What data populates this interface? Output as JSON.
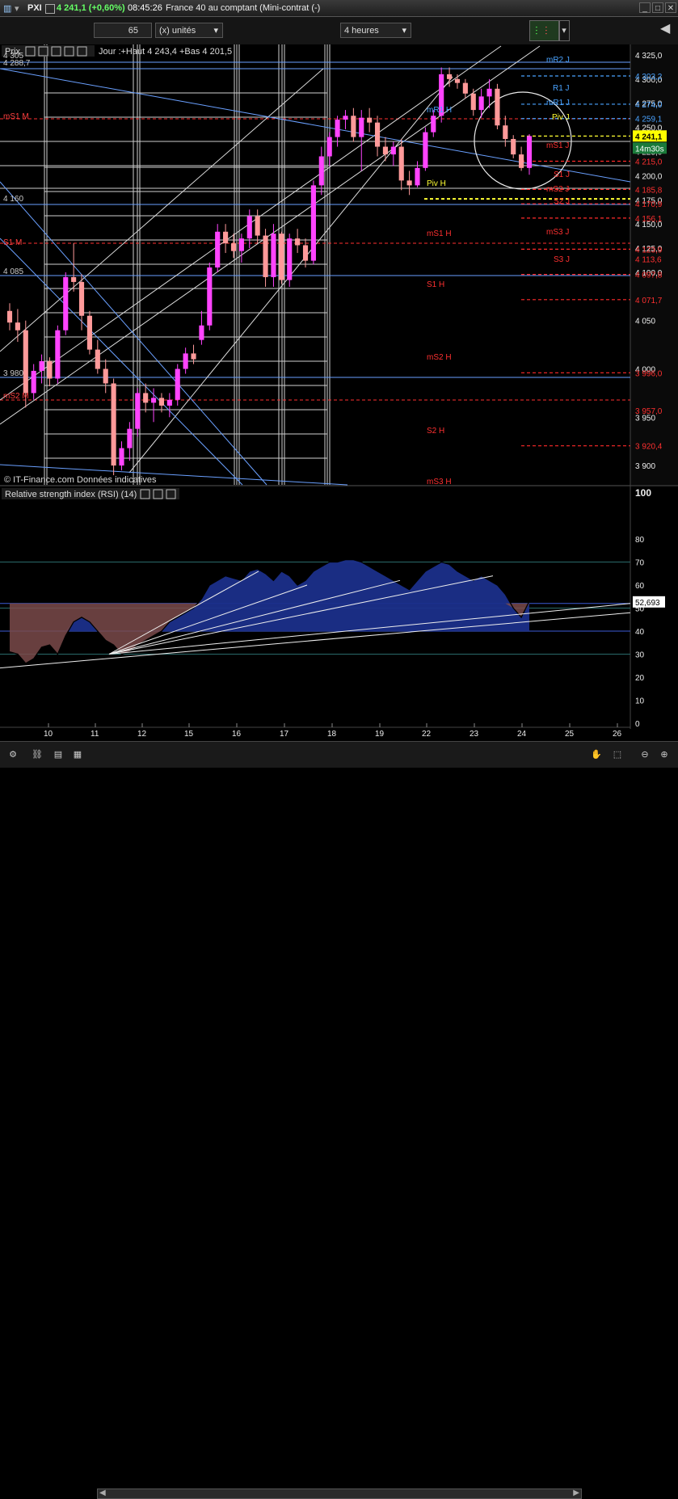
{
  "window": {
    "instrument": "PXI",
    "quote": "4 241,1 (+0,60%)",
    "time": "08:45:26",
    "title": "France 40 au comptant (Mini-contrat  (-)"
  },
  "toolbar": {
    "quantity": "65",
    "units": "(x) unités",
    "period": "4 heures"
  },
  "panel_price": {
    "label": "Prix",
    "info": "Jour :+Haut 4 243,4 +Bas 4 201,5",
    "copyright": "© IT-Finance.com Données indicatives",
    "last_price": "4 241,1",
    "countdown": "14m30s",
    "price_ticks": [
      "4 325,0",
      "4 300,0",
      "4 275,0",
      "4 250,0",
      "4 225,0",
      "4 200,0",
      "4 175,0",
      "4 150,0",
      "4 125,0",
      "4 100,0",
      "4 050",
      "4 000",
      "3 950",
      "3 900"
    ],
    "level_tags": [
      "4 303,2",
      "4 274,0",
      "4 259,1",
      "4 215,0",
      "4 185,8",
      "4 170,9",
      "4 156,1",
      "4 123,9",
      "4 113,6",
      "4 097,8",
      "4 071,7",
      "3 996,0",
      "3 957,0",
      "3 920,4"
    ],
    "left_labels": [
      "4 305",
      "4 288,7",
      "mS1 M",
      "4 160",
      "S1 M",
      "4 085",
      "3 980",
      "mS2 M"
    ],
    "pivot_labels": [
      "mR2 J",
      "R1 J",
      "mR1 J",
      "mR1 H",
      "Piv J",
      "mS1 J",
      "S1 J",
      "Piv H",
      "mS2 J",
      "S2 J",
      "mS1 H",
      "mS3 J",
      "S3 J",
      "S1 H",
      "mS2 H",
      "S2 H",
      "mS3 H"
    ]
  },
  "panel_rsi": {
    "label": "Relative strength index (RSI) (14)",
    "value": "52,693",
    "ticks": [
      "100",
      "80",
      "70",
      "60",
      "50",
      "40",
      "30",
      "20",
      "10",
      "0"
    ]
  },
  "x_axis": {
    "labels": [
      "10",
      "11",
      "12",
      "15",
      "16",
      "17",
      "18",
      "19",
      "22",
      "23",
      "24",
      "25",
      "26"
    ]
  },
  "colors": {
    "up": "#ff44ff",
    "down": "#ff9a9a",
    "support": "#ff2a2a",
    "resistance": "#4aa3ff",
    "pivot": "#ffff33",
    "rsi_fill": "#1b2f8a",
    "rsi_low_fill": "#7a4a4a"
  },
  "chart_data": {
    "type": "candlestick",
    "ylim": [
      3880,
      4335
    ],
    "candles": [
      {
        "x": 1,
        "o": 4060,
        "h": 4068,
        "l": 4040,
        "c": 4048
      },
      {
        "x": 2,
        "o": 4048,
        "h": 4062,
        "l": 4028,
        "c": 4040
      },
      {
        "x": 3,
        "o": 4040,
        "h": 4050,
        "l": 3960,
        "c": 3975
      },
      {
        "x": 4,
        "o": 3975,
        "h": 4005,
        "l": 3968,
        "c": 3998
      },
      {
        "x": 5,
        "o": 3998,
        "h": 4015,
        "l": 3985,
        "c": 4008
      },
      {
        "x": 6,
        "o": 4008,
        "h": 4012,
        "l": 3982,
        "c": 3990
      },
      {
        "x": 7,
        "o": 3990,
        "h": 4045,
        "l": 3985,
        "c": 4040
      },
      {
        "x": 8,
        "o": 4040,
        "h": 4100,
        "l": 4035,
        "c": 4095
      },
      {
        "x": 9,
        "o": 4095,
        "h": 4130,
        "l": 4080,
        "c": 4090
      },
      {
        "x": 10,
        "o": 4090,
        "h": 4098,
        "l": 4040,
        "c": 4055
      },
      {
        "x": 11,
        "o": 4055,
        "h": 4060,
        "l": 4015,
        "c": 4020
      },
      {
        "x": 12,
        "o": 4020,
        "h": 4030,
        "l": 3995,
        "c": 4000
      },
      {
        "x": 13,
        "o": 4000,
        "h": 4010,
        "l": 3975,
        "c": 3985
      },
      {
        "x": 14,
        "o": 3985,
        "h": 3990,
        "l": 3890,
        "c": 3900
      },
      {
        "x": 15,
        "o": 3900,
        "h": 3925,
        "l": 3895,
        "c": 3918
      },
      {
        "x": 16,
        "o": 3918,
        "h": 3945,
        "l": 3905,
        "c": 3938
      },
      {
        "x": 17,
        "o": 3938,
        "h": 3980,
        "l": 3930,
        "c": 3975
      },
      {
        "x": 18,
        "o": 3975,
        "h": 3985,
        "l": 3955,
        "c": 3965
      },
      {
        "x": 19,
        "o": 3965,
        "h": 3980,
        "l": 3945,
        "c": 3970
      },
      {
        "x": 20,
        "o": 3970,
        "h": 3975,
        "l": 3955,
        "c": 3962
      },
      {
        "x": 21,
        "o": 3962,
        "h": 3975,
        "l": 3950,
        "c": 3968
      },
      {
        "x": 22,
        "o": 3968,
        "h": 4005,
        "l": 3962,
        "c": 4000
      },
      {
        "x": 23,
        "o": 4000,
        "h": 4022,
        "l": 3995,
        "c": 4016
      },
      {
        "x": 24,
        "o": 4016,
        "h": 4025,
        "l": 4005,
        "c": 4010
      },
      {
        "x": 25,
        "o": 4030,
        "h": 4060,
        "l": 4025,
        "c": 4045
      },
      {
        "x": 26,
        "o": 4045,
        "h": 4110,
        "l": 4040,
        "c": 4105
      },
      {
        "x": 27,
        "o": 4105,
        "h": 4150,
        "l": 4100,
        "c": 4142
      },
      {
        "x": 28,
        "o": 4142,
        "h": 4150,
        "l": 4120,
        "c": 4130
      },
      {
        "x": 29,
        "o": 4130,
        "h": 4140,
        "l": 4115,
        "c": 4122
      },
      {
        "x": 30,
        "o": 4122,
        "h": 4140,
        "l": 4110,
        "c": 4135
      },
      {
        "x": 31,
        "o": 4135,
        "h": 4165,
        "l": 4125,
        "c": 4158
      },
      {
        "x": 32,
        "o": 4158,
        "h": 4165,
        "l": 4130,
        "c": 4138
      },
      {
        "x": 33,
        "o": 4138,
        "h": 4145,
        "l": 4085,
        "c": 4095
      },
      {
        "x": 34,
        "o": 4095,
        "h": 4150,
        "l": 4085,
        "c": 4140
      },
      {
        "x": 35,
        "o": 4140,
        "h": 4142,
        "l": 4088,
        "c": 4092
      },
      {
        "x": 36,
        "o": 4092,
        "h": 4140,
        "l": 4085,
        "c": 4135
      },
      {
        "x": 37,
        "o": 4135,
        "h": 4145,
        "l": 4120,
        "c": 4128
      },
      {
        "x": 38,
        "o": 4128,
        "h": 4135,
        "l": 4105,
        "c": 4112
      },
      {
        "x": 39,
        "o": 4112,
        "h": 4195,
        "l": 4108,
        "c": 4190
      },
      {
        "x": 40,
        "o": 4190,
        "h": 4230,
        "l": 4180,
        "c": 4220
      },
      {
        "x": 41,
        "o": 4220,
        "h": 4245,
        "l": 4210,
        "c": 4240
      },
      {
        "x": 42,
        "o": 4240,
        "h": 4262,
        "l": 4230,
        "c": 4258
      },
      {
        "x": 43,
        "o": 4258,
        "h": 4268,
        "l": 4248,
        "c": 4262
      },
      {
        "x": 44,
        "o": 4262,
        "h": 4270,
        "l": 4235,
        "c": 4240
      },
      {
        "x": 45,
        "o": 4240,
        "h": 4268,
        "l": 4205,
        "c": 4260
      },
      {
        "x": 46,
        "o": 4260,
        "h": 4270,
        "l": 4245,
        "c": 4255
      },
      {
        "x": 47,
        "o": 4255,
        "h": 4262,
        "l": 4220,
        "c": 4230
      },
      {
        "x": 48,
        "o": 4230,
        "h": 4240,
        "l": 4215,
        "c": 4222
      },
      {
        "x": 49,
        "o": 4222,
        "h": 4235,
        "l": 4210,
        "c": 4230
      },
      {
        "x": 50,
        "o": 4230,
        "h": 4238,
        "l": 4185,
        "c": 4195
      },
      {
        "x": 51,
        "o": 4195,
        "h": 4205,
        "l": 4180,
        "c": 4190
      },
      {
        "x": 52,
        "o": 4190,
        "h": 4215,
        "l": 4188,
        "c": 4208
      },
      {
        "x": 53,
        "o": 4208,
        "h": 4250,
        "l": 4205,
        "c": 4245
      },
      {
        "x": 54,
        "o": 4245,
        "h": 4268,
        "l": 4240,
        "c": 4262
      },
      {
        "x": 55,
        "o": 4262,
        "h": 4312,
        "l": 4255,
        "c": 4305
      },
      {
        "x": 56,
        "o": 4305,
        "h": 4312,
        "l": 4292,
        "c": 4300
      },
      {
        "x": 57,
        "o": 4300,
        "h": 4305,
        "l": 4290,
        "c": 4296
      },
      {
        "x": 58,
        "o": 4296,
        "h": 4300,
        "l": 4280,
        "c": 4285
      },
      {
        "x": 59,
        "o": 4285,
        "h": 4290,
        "l": 4262,
        "c": 4268
      },
      {
        "x": 60,
        "o": 4268,
        "h": 4290,
        "l": 4260,
        "c": 4282
      },
      {
        "x": 61,
        "o": 4282,
        "h": 4300,
        "l": 4270,
        "c": 4290
      },
      {
        "x": 62,
        "o": 4290,
        "h": 4295,
        "l": 4248,
        "c": 4252
      },
      {
        "x": 63,
        "o": 4252,
        "h": 4262,
        "l": 4230,
        "c": 4238
      },
      {
        "x": 64,
        "o": 4238,
        "h": 4242,
        "l": 4218,
        "c": 4222
      },
      {
        "x": 65,
        "o": 4222,
        "h": 4230,
        "l": 4205,
        "c": 4208
      },
      {
        "x": 66,
        "o": 4208,
        "h": 4243,
        "l": 4201,
        "c": 4241
      }
    ],
    "rsi": [
      31,
      30,
      26,
      28,
      33,
      34,
      30,
      38,
      44,
      46,
      44,
      40,
      36,
      34,
      30,
      31,
      34,
      36,
      38,
      40,
      44,
      46,
      48,
      50,
      54,
      60,
      62,
      64,
      63,
      62,
      66,
      67,
      65,
      62,
      66,
      64,
      60,
      62,
      66,
      68,
      70,
      70,
      71,
      71,
      70,
      68,
      66,
      64,
      62,
      60,
      58,
      62,
      66,
      68,
      70,
      69,
      66,
      64,
      62,
      64,
      62,
      60,
      56,
      50,
      46,
      53
    ],
    "pivot_levels": [
      {
        "name": "mR2 J",
        "value": 4303.2
      },
      {
        "name": "R1 J",
        "value": 4274.0
      },
      {
        "name": "mR1 J",
        "value": 4259.1
      },
      {
        "name": "Piv J",
        "value": 4241.0
      },
      {
        "name": "mS1 J",
        "value": 4215.0
      },
      {
        "name": "S1 J",
        "value": 4185.8
      },
      {
        "name": "Piv H",
        "value": 4176.0
      },
      {
        "name": "mS2 J",
        "value": 4170.9
      },
      {
        "name": "S2 J",
        "value": 4156.1
      },
      {
        "name": "mS3 J",
        "value": 4123.9
      },
      {
        "name": "S3 J",
        "value": 4097.8
      },
      {
        "name": "S1 H",
        "value": 4071.7
      },
      {
        "name": "mS2 H",
        "value": 3996.0
      },
      {
        "name": "S2 H",
        "value": 3920.4
      }
    ]
  }
}
